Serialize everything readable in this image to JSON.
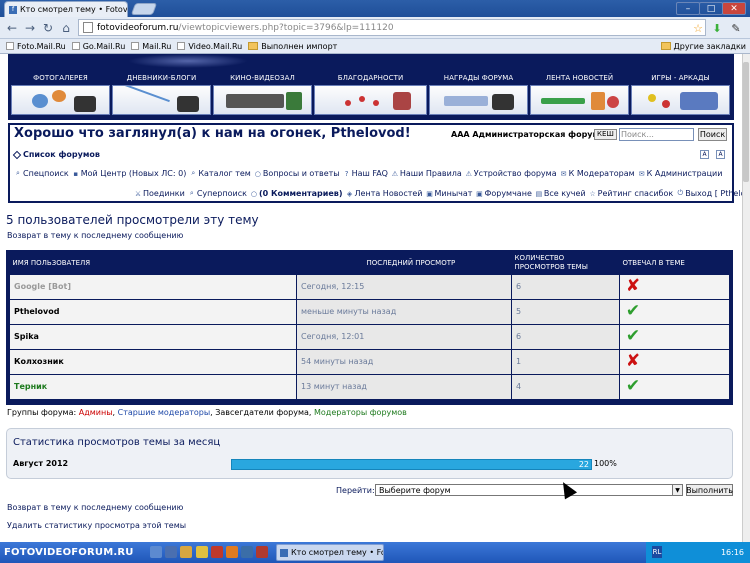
{
  "browser": {
    "tab_title": "Кто смотрел тему • Fotovide",
    "url_domain": "fotovideoforum.ru",
    "url_path": "/viewtopicviewers.php?topic=3796&lp=111120",
    "bookmarks": [
      "Foto.Mail.Ru",
      "Go.Mail.Ru",
      "Mail.Ru",
      "Video.Mail.Ru",
      "Выполнен импорт"
    ],
    "other_bookmarks": "Другие закладки"
  },
  "nav": [
    {
      "label": "ФОТОГАЛЕРЕЯ"
    },
    {
      "label": "ДНЕВНИКИ-БЛОГИ"
    },
    {
      "label": "КИНО-ВИДЕОЗАЛ"
    },
    {
      "label": "БЛАГОДАРНОСТИ"
    },
    {
      "label": "НАГРАДЫ ФОРУМА"
    },
    {
      "label": "ЛЕНТА НОВОСТЕЙ"
    },
    {
      "label": "ИГРЫ - АРКАДЫ"
    }
  ],
  "header": {
    "welcome": "Хорошо что заглянул(а) к нам на огонек, Pthelovod!",
    "admin_forum": "AAA Администраторская форума",
    "cache_btn": "КЕШ",
    "search_placeholder": "Поиск...",
    "search_btn": "Поиск",
    "forum_list": "Список форумов",
    "links_row1": [
      "Спецпоиск",
      "Мой Центр (Новых ЛС: 0)",
      "Каталог тем",
      "Вопросы и ответы",
      "Наш FAQ",
      "Наши Правила",
      "Устройство форума",
      "К Модераторам",
      "К Администрации"
    ],
    "links_row2": [
      "Поединки",
      "Суперпоиск",
      "(0 Комментариев)",
      "Лента Новостей",
      "Минычат",
      "Форумчане",
      "Все кучей",
      "Рейтинг спасибок",
      "Выход [ Pthelovod ]"
    ]
  },
  "main": {
    "title": "5 пользователей просмотрели эту тему",
    "back_link": "Возврат в тему к последнему сообщению",
    "columns": [
      "ИМЯ ПОЛЬЗОВАТЕЛЯ",
      "ПОСЛЕДНИЙ ПРОСМОТР",
      "КОЛИЧЕСТВО ПРОСМОТРОВ ТЕМЫ",
      "ОТВЕЧАЛ В ТЕМЕ"
    ],
    "rows": [
      {
        "name": "Google [Bot]",
        "name_color": "#9a9a9a",
        "last": "Сегодня, 12:15",
        "count": "6",
        "replied": false
      },
      {
        "name": "Pthelovod",
        "name_color": "#000000",
        "last": "меньше минуты назад",
        "count": "5",
        "replied": true
      },
      {
        "name": "Spika",
        "name_color": "#000000",
        "last": "Сегодня, 12:01",
        "count": "6",
        "replied": true
      },
      {
        "name": "Колхозник",
        "name_color": "#000000",
        "last": "54 минуты назад",
        "count": "1",
        "replied": false
      },
      {
        "name": "Терник",
        "name_color": "#1e7a1e",
        "last": "13 минут назад",
        "count": "4",
        "replied": true
      }
    ],
    "groups_label": "Группы форума:",
    "groups": [
      {
        "name": "Админы",
        "color": "#cc0000"
      },
      {
        "name": "Старшие модераторы",
        "color": "#1f49a8"
      },
      {
        "name": "Завсегдатели форума",
        "color": "#000000"
      },
      {
        "name": "Модераторы форумов",
        "color": "#1e7a1e"
      }
    ],
    "stats_title": "Статистика просмотров темы за месяц",
    "stats_month": "Август 2012",
    "stats_value": "22",
    "stats_percent": "100%",
    "stats_fraction": 1.0,
    "goto_label": "Перейти:",
    "goto_select": "Выберите форум",
    "goto_btn": "Выполнить",
    "back_link2": "Возврат в тему к последнему сообщению",
    "delete_stats": "Удалить статистику просмотра этой темы"
  },
  "taskbar": {
    "brand": "FOTOVIDEOFORUM.RU",
    "task": "Кто смотрел тему • Fot...",
    "lang": "RL",
    "time": "16:16"
  },
  "colors": {
    "navy": "#0a1a5c",
    "check": "#2e9e2e",
    "cross": "#cc1111",
    "bar": "#29a7df"
  }
}
